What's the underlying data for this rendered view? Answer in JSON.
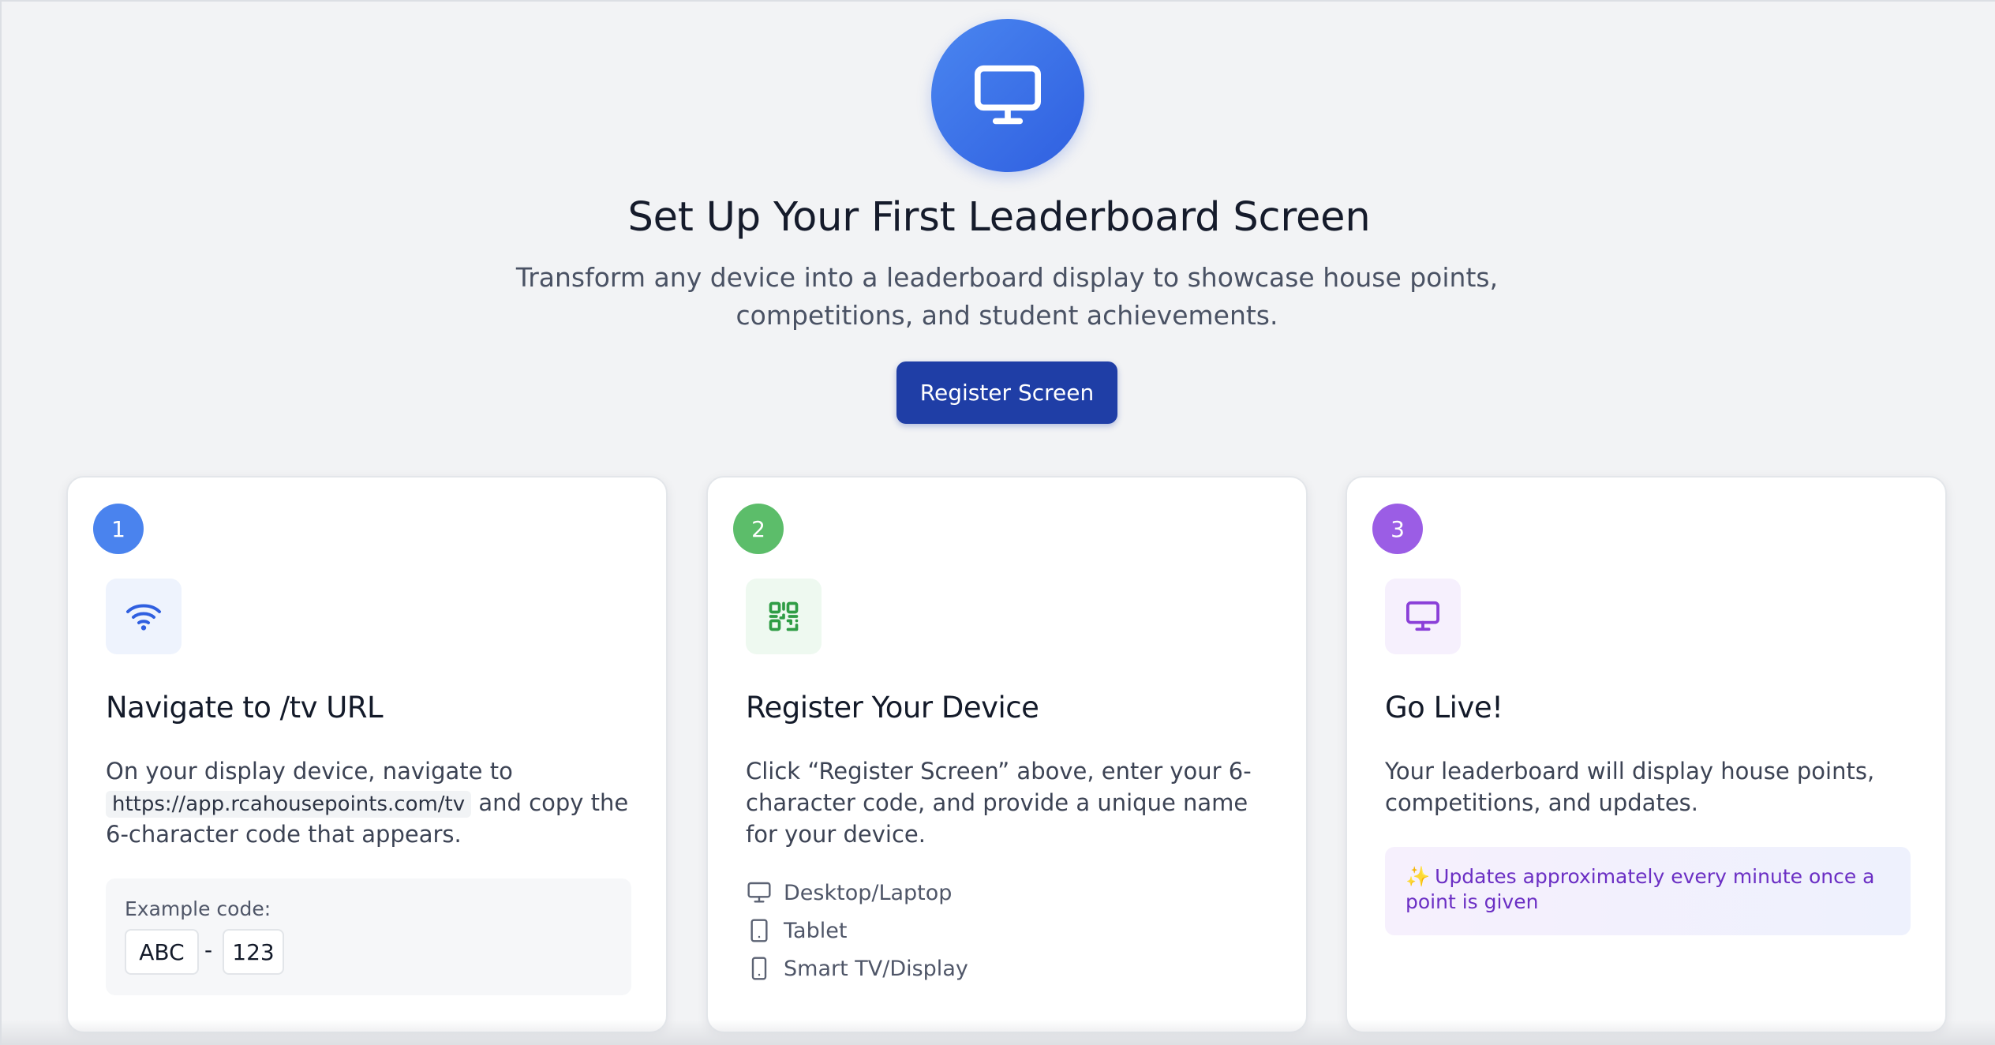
{
  "hero": {
    "icon": "monitor-icon",
    "title": "Set Up Your First Leaderboard Screen",
    "subtitle_line1": "Transform any device into a leaderboard display to showcase house points,",
    "subtitle_line2": "competitions, and student achievements.",
    "register_button": "Register Screen"
  },
  "colors": {
    "primary": "#1f3ea6",
    "step1": "#4a83ee",
    "step2": "#5cbd6a",
    "step3": "#9b5de5"
  },
  "steps": [
    {
      "number": "1",
      "icon": "wifi-icon",
      "title": "Navigate to /tv URL",
      "body_before": "On your display device, navigate to",
      "url": "https://app.rcahousepoints.com/tv",
      "body_after": "and copy the 6-character code that appears.",
      "example_label": "Example code:",
      "code_part1": "ABC",
      "code_sep": "-",
      "code_part2": "123"
    },
    {
      "number": "2",
      "icon": "qr-code-icon",
      "title": "Register Your Device",
      "body": "Click “Register Screen” above, enter your 6-character code, and provide a unique name for your device.",
      "devices": [
        {
          "icon": "desktop-icon",
          "label": "Desktop/Laptop"
        },
        {
          "icon": "tablet-icon",
          "label": "Tablet"
        },
        {
          "icon": "smartphone-icon",
          "label": "Smart TV/Display"
        }
      ]
    },
    {
      "number": "3",
      "icon": "monitor-icon",
      "title": "Go Live!",
      "body": "Your leaderboard will display house points, competitions, and updates.",
      "note_icon": "sparkles-icon",
      "note": "Updates approximately every minute once a point is given"
    }
  ]
}
